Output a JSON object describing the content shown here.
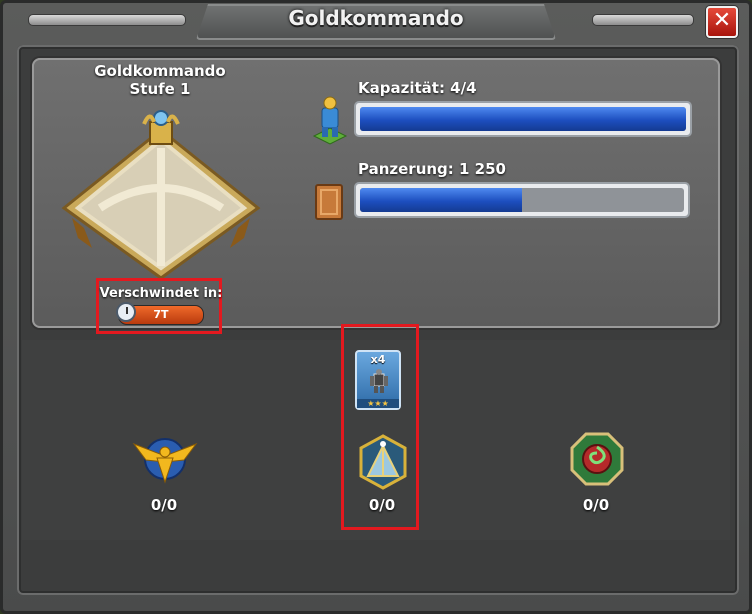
{
  "window": {
    "title": "Goldkommando",
    "close_symbol": "✕"
  },
  "building": {
    "name": "Goldkommando",
    "level": "Stufe 1"
  },
  "vanish": {
    "label": "Verschwindet in:",
    "value": "7T"
  },
  "stats": {
    "capacity": {
      "label": "Kapazität: 4/4",
      "fraction": 1.0
    },
    "armor": {
      "label": "Panzerung: 1 250",
      "fraction": 0.5
    }
  },
  "troop": {
    "count": "x4",
    "stars": "★★★"
  },
  "slots": [
    {
      "icon": "golden-eagle-emblem-icon",
      "count": "0/0"
    },
    {
      "icon": "pyramid-emblem-icon",
      "count": "0/0"
    },
    {
      "icon": "green-vortex-emblem-icon",
      "count": "0/0"
    }
  ],
  "colors": {
    "bar_fill": "#1d4fbf",
    "highlight": "#e3191f",
    "timer": "#e2561f"
  }
}
